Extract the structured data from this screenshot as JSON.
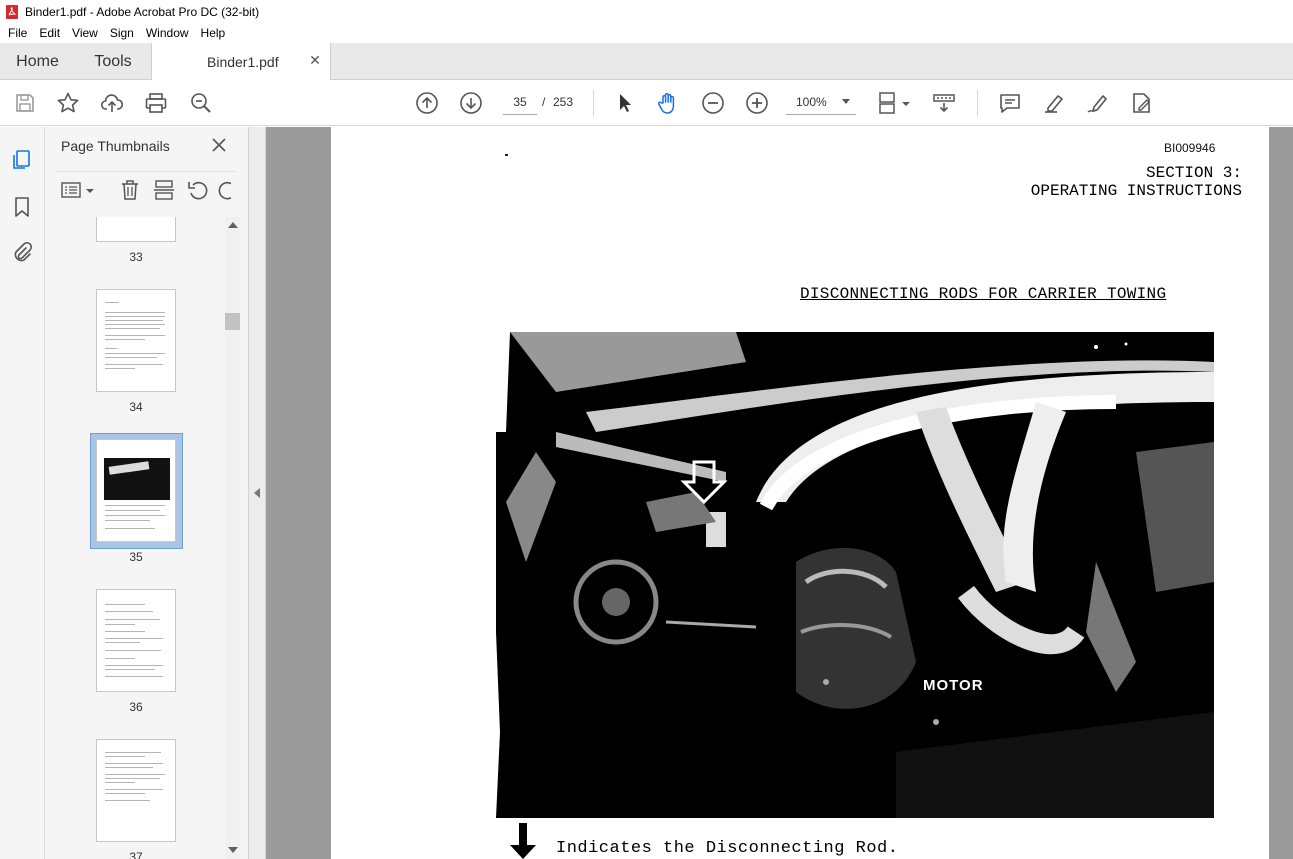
{
  "window": {
    "title": "Binder1.pdf - Adobe Acrobat Pro DC (32-bit)"
  },
  "menu": [
    "File",
    "Edit",
    "View",
    "Sign",
    "Window",
    "Help"
  ],
  "tabs": {
    "home": "Home",
    "tools": "Tools",
    "document": "Binder1.pdf"
  },
  "toolbar": {
    "current_page": "35",
    "page_separator": "/",
    "total_pages": "253",
    "zoom": "100%"
  },
  "panel": {
    "title": "Page Thumbnails",
    "thumbnails": [
      {
        "page": "33"
      },
      {
        "page": "34"
      },
      {
        "page": "35",
        "selected": true
      },
      {
        "page": "36"
      },
      {
        "page": "37"
      }
    ]
  },
  "document": {
    "doc_id": "BI009946",
    "section_line1": "SECTION 3:",
    "section_line2": "OPERATING INSTRUCTIONS",
    "heading": "DISCONNECTING RODS FOR CARRIER TOWING",
    "photo_label": "MOTOR",
    "caption": "Indicates the Disconnecting Rod."
  },
  "colors": {
    "accent": "#1473e6",
    "selection": "#a9c5e3",
    "canvas": "#9b9b9b",
    "pdf_icon": "#d7282f"
  }
}
